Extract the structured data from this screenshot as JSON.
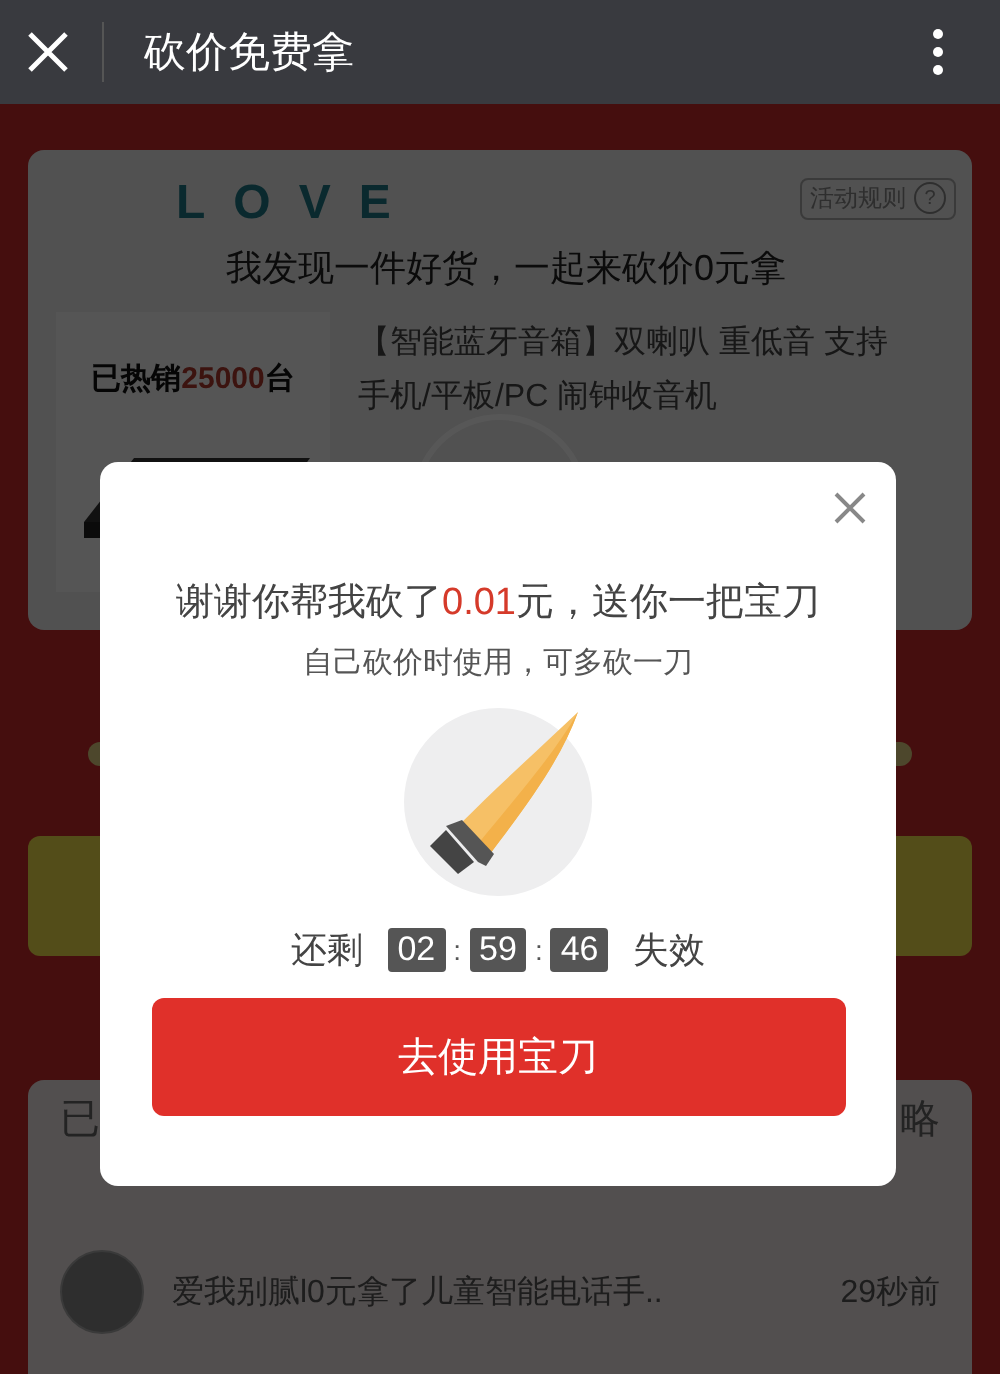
{
  "header": {
    "title": "砍价免费拿"
  },
  "campaign": {
    "logo": "LOVE",
    "rules_label": "活动规则",
    "rules_icon": "?",
    "headline": "我发现一件好货，一起来砍价0元拿",
    "product": {
      "sales_prefix": "已热销",
      "sales_count": "25000",
      "sales_unit": "台",
      "title": "【智能蓝牙音箱】双喇叭 重低音 支持手机/平板/PC 闹钟收音机"
    }
  },
  "helpers": {
    "header_left": "已",
    "header_right": "略",
    "rows": [
      {
        "text": "爱我别腻l0元拿了儿童智能电话手..",
        "time": "29秒前"
      }
    ]
  },
  "modal": {
    "message_prefix": "谢谢你帮我砍了",
    "amount": "0.01",
    "message_suffix": "元，送你一把宝刀",
    "subtitle": "自己砍价时使用，可多砍一刀",
    "countdown": {
      "before": "还剩",
      "segments": [
        {
          "kind": "digits",
          "text": "02"
        },
        {
          "kind": "separator",
          "text": ":"
        },
        {
          "kind": "digits",
          "text": "59"
        },
        {
          "kind": "separator",
          "text": ":"
        },
        {
          "kind": "digits",
          "text": "46"
        }
      ],
      "after": "失效"
    },
    "button": "去使用宝刀"
  }
}
